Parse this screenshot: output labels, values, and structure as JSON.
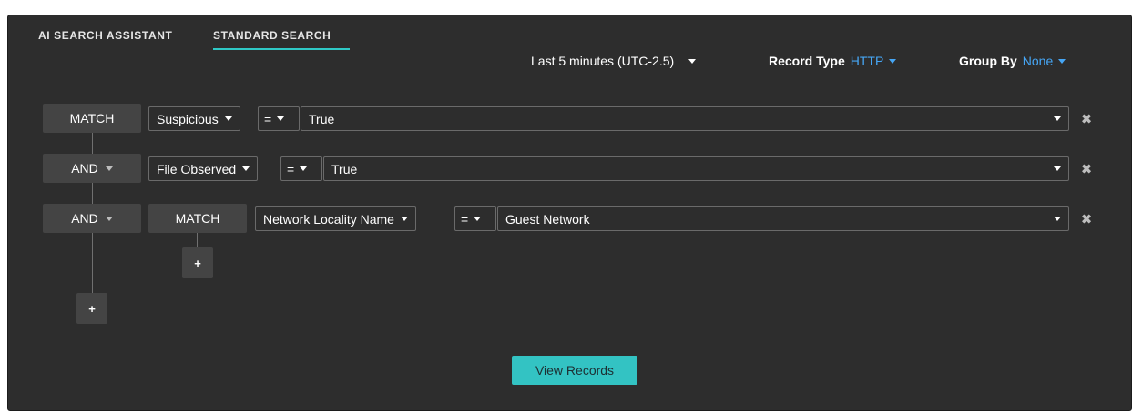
{
  "tabs": {
    "ai_search": "AI SEARCH ASSISTANT",
    "standard_search": "STANDARD SEARCH",
    "active": "standard_search"
  },
  "header": {
    "time_range": "Last 5 minutes (UTC-2.5)",
    "record_type": {
      "label": "Record Type",
      "value": "HTTP"
    },
    "group_by": {
      "label": "Group By",
      "value": "None"
    }
  },
  "query": {
    "rows": [
      {
        "operator": "MATCH",
        "field": "Suspicious",
        "comparator": "=",
        "value": "True"
      },
      {
        "operator": "AND",
        "field": "File Observed",
        "comparator": "=",
        "value": "True"
      },
      {
        "operator": "AND",
        "group_operator": "MATCH",
        "field": "Network Locality Name",
        "comparator": "=",
        "value": "Guest Network"
      }
    ],
    "add_label": "+",
    "remove_glyph": "✖"
  },
  "actions": {
    "view_records": "View Records"
  },
  "colors": {
    "panel_bg": "#2d2d2d",
    "accent_teal": "#33c3c3",
    "link_blue": "#46a6f5"
  }
}
